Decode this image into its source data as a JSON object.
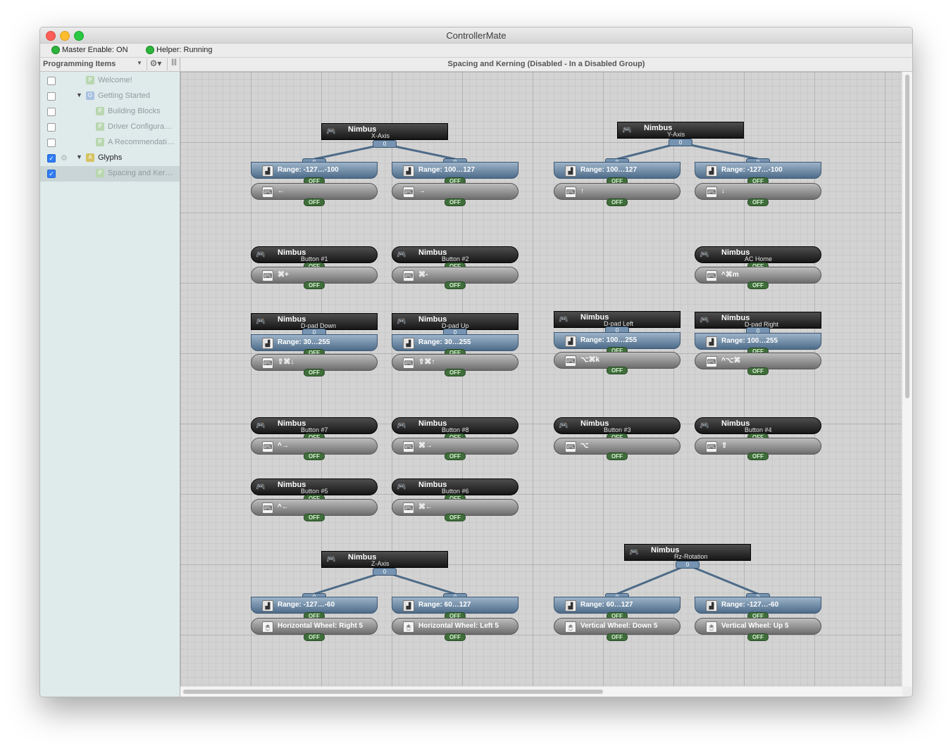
{
  "window": {
    "title": "ControllerMate"
  },
  "status": {
    "master": "Master Enable: ON",
    "helper": "Helper: Running"
  },
  "sidebar": {
    "title": "Programming Items",
    "items": [
      {
        "label": "Welcome!",
        "badge": "P",
        "checked": false,
        "dim": true
      },
      {
        "label": "Getting Started",
        "badge": "G",
        "checked": false,
        "dim": true
      },
      {
        "label": "Building Blocks",
        "badge": "P",
        "checked": false,
        "dim": true
      },
      {
        "label": "Driver Configura…",
        "badge": "P",
        "checked": false,
        "dim": true
      },
      {
        "label": "A Recommendati…",
        "badge": "P",
        "checked": false,
        "dim": true
      },
      {
        "label": "Glyphs",
        "badge": "A",
        "checked": true,
        "dim": false
      },
      {
        "label": "Spacing and Ker…",
        "badge": "P",
        "checked": true,
        "dim": true
      }
    ]
  },
  "main": {
    "header": "Spacing and Kerning  (Disabled - In a Disabled Group)"
  },
  "canvas": {
    "device": "Nimbus",
    "state_off": "OFF",
    "zero": "0",
    "axes": [
      {
        "name": "X-Axis",
        "ranges": [
          "Range: -127…-100",
          "Range: 100…127"
        ],
        "outputs": [
          "←",
          "→"
        ]
      },
      {
        "name": "Y-Axis",
        "ranges": [
          "Range: 100…127",
          "Range: -127…-100"
        ],
        "outputs": [
          "↑",
          "↓"
        ]
      },
      {
        "name": "Z-Axis",
        "ranges": [
          "Range: -127…-60",
          "Range: 60…127"
        ],
        "outputs": [
          "Horizontal Wheel: Right 5",
          "Horizontal Wheel: Left 5"
        ]
      },
      {
        "name": "Rz-Rotation",
        "ranges": [
          "Range: 60…127",
          "Range: -127…-60"
        ],
        "outputs": [
          "Vertical Wheel: Down 5",
          "Vertical Wheel: Up 5"
        ]
      }
    ],
    "buttons": [
      {
        "name": "Button #1",
        "output": "⌘+"
      },
      {
        "name": "Button #2",
        "output": "⌘-"
      },
      {
        "name": "AC Home",
        "output": "^⌘m"
      },
      {
        "name": "Button #7",
        "output": "^→"
      },
      {
        "name": "Button #8",
        "output": "⌘→"
      },
      {
        "name": "Button #3",
        "output": "⌥"
      },
      {
        "name": "Button #4",
        "output": "⇧"
      },
      {
        "name": "Button #5",
        "output": "^←"
      },
      {
        "name": "Button #6",
        "output": "⌘←"
      }
    ],
    "dpads": [
      {
        "name": "D-pad Down",
        "range": "Range: 30…255",
        "output": "⇧⌘↓"
      },
      {
        "name": "D-pad Up",
        "range": "Range: 30…255",
        "output": "⇧⌘↑"
      },
      {
        "name": "D-pad Left",
        "range": "Range: 100…255",
        "output": "⌥⌘k"
      },
      {
        "name": "D-pad Right",
        "range": "Range: 100…255",
        "output": "^⌥⌘"
      }
    ]
  }
}
